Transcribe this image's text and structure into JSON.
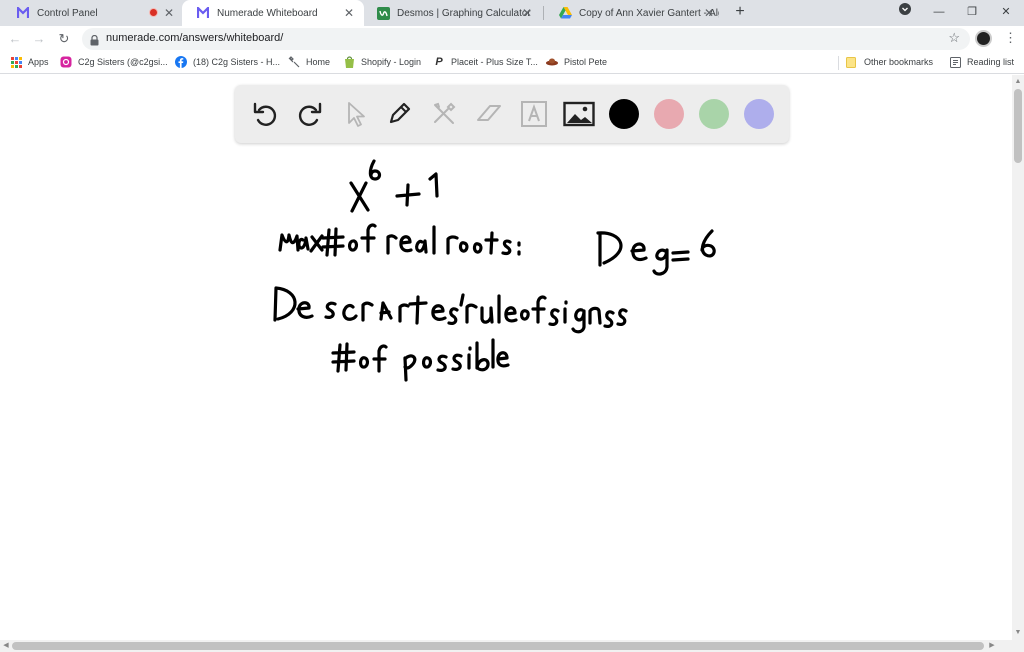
{
  "tabs": [
    {
      "title": "Control Panel",
      "icon": "numerade-logo-icon",
      "recording": true
    },
    {
      "title": "Numerade Whiteboard",
      "icon": "numerade-logo-icon",
      "active": true
    },
    {
      "title": "Desmos | Graphing Calculator",
      "icon": "desmos-icon"
    },
    {
      "title": "Copy of Ann Xavier Gantert - Alg",
      "icon": "google-drive-icon"
    }
  ],
  "address_bar": {
    "url": "numerade.com/answers/whiteboard/"
  },
  "bookmarks": [
    {
      "label": "Apps",
      "icon": "apps-grid-icon"
    },
    {
      "label": "C2g Sisters (@c2gsi...",
      "icon": "instagram-icon"
    },
    {
      "label": "(18) C2g Sisters - H...",
      "icon": "facebook-icon"
    },
    {
      "label": "Home",
      "icon": "home-tools-icon"
    },
    {
      "label": "Shopify - Login",
      "icon": "shopify-icon"
    },
    {
      "label": "Placeit - Plus Size T...",
      "icon": "placeit-icon"
    },
    {
      "label": "Pistol Pete",
      "icon": "pistol-pete-icon"
    },
    {
      "label": "Other bookmarks",
      "icon": "folder-icon"
    },
    {
      "label": "Reading list",
      "icon": "reading-list-icon"
    }
  ],
  "whiteboard": {
    "tools": [
      "undo-icon",
      "redo-icon",
      "pointer-icon",
      "pen-icon",
      "tools-icon",
      "eraser-icon",
      "text-icon",
      "image-icon"
    ],
    "colors": [
      "#000000",
      "#e8a9b0",
      "#a9d4a9",
      "#aeaeec"
    ],
    "handwriting": [
      "x^6 + 1",
      "max # of real roots: Deg = 6",
      "Descartes' rule of signs",
      "# of possible"
    ]
  }
}
